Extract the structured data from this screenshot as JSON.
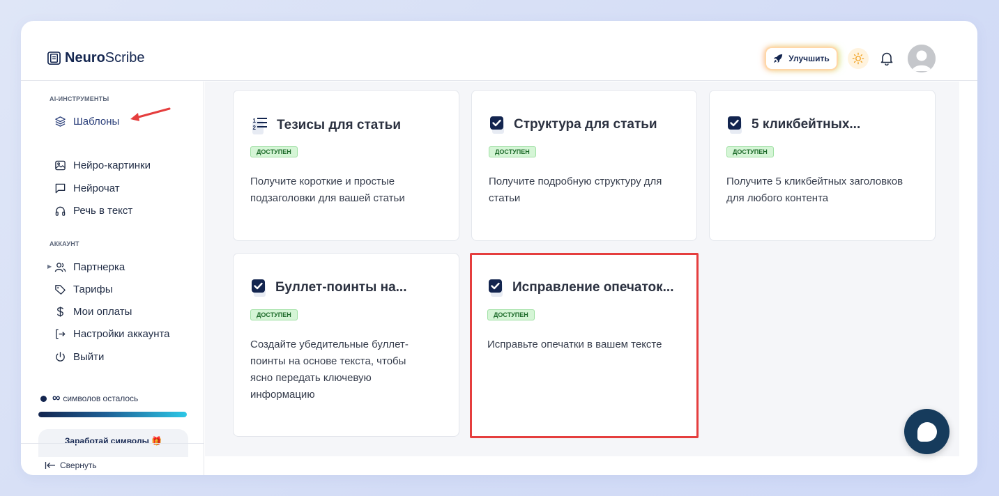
{
  "app": {
    "brand_bold": "Neuro",
    "brand_light": "Scribe"
  },
  "header": {
    "upgrade_label": "Улучшить"
  },
  "sidebar": {
    "section_ai": "AI-ИНСТРУМЕНТЫ",
    "ai_items": [
      {
        "label": "Шаблоны",
        "icon": "layers-icon",
        "active": true
      },
      {
        "label": "Нейро-картинки",
        "icon": "image-icon"
      },
      {
        "label": "Нейрочат",
        "icon": "chat-icon"
      },
      {
        "label": "Речь в текст",
        "icon": "headphones-icon"
      }
    ],
    "section_account": "АККАУНТ",
    "account_items": [
      {
        "label": "Партнерка",
        "icon": "users-icon"
      },
      {
        "label": "Тарифы",
        "icon": "tag-icon"
      },
      {
        "label": "Мои оплаты",
        "icon": "dollar-icon"
      },
      {
        "label": "Настройки аккаунта",
        "icon": "logout-arrow-icon"
      },
      {
        "label": "Выйти",
        "icon": "power-icon"
      }
    ],
    "symbols_infinity": "∞",
    "symbols_text": "символов осталось",
    "symbols_progress": 1.0,
    "earn_label": "Заработай символы 🎁",
    "collapse_label": "Свернуть"
  },
  "cards": [
    {
      "title": "Тезисы для статьи",
      "badge": "ДОСТУПЕН",
      "desc": "Получите короткие и простые подзаголовки для вашей статьи",
      "icon": "list-icon"
    },
    {
      "title": "Структура для статьи",
      "badge": "ДОСТУПЕН",
      "desc": "Получите подробную структуру для статьи",
      "icon": "checkbox-icon"
    },
    {
      "title": "5 кликбейтных...",
      "badge": "ДОСТУПЕН",
      "desc": "Получите 5 кликбейтных заголовков для любого контента",
      "icon": "checkbox-icon"
    },
    {
      "title": "Буллет-поинты на...",
      "badge": "ДОСТУПЕН",
      "desc": "Создайте убедительные буллет-поинты на основе текста, чтобы ясно передать ключевую информацию",
      "icon": "checkbox-icon"
    },
    {
      "title": "Исправление опечаток...",
      "badge": "ДОСТУПЕН",
      "desc": "Исправьте опечатки в вашем тексте",
      "icon": "checkbox-icon",
      "highlighted": true
    }
  ],
  "colors": {
    "brand": "#13254f",
    "badge_bg": "#d5f5d6",
    "highlight": "#e53e3e",
    "chat_fab": "#163b5c"
  }
}
